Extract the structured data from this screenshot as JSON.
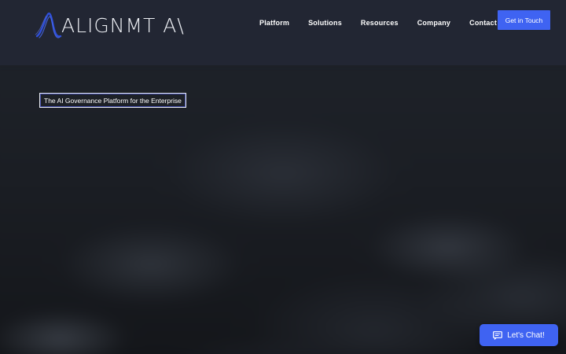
{
  "brand": {
    "name": "ALIGNMT A\\",
    "logo_icon": "wave-logo-icon"
  },
  "nav": {
    "items": [
      {
        "label": "Platform"
      },
      {
        "label": "Solutions"
      },
      {
        "label": "Resources"
      },
      {
        "label": "Company"
      },
      {
        "label": "Contact"
      }
    ],
    "cta_label": "Get in Touch"
  },
  "hero": {
    "tagline": "The AI Governance Platform for the Enterprise"
  },
  "chat": {
    "label": "Let's Chat!",
    "icon": "chat-bubble-icon"
  },
  "colors": {
    "header_bg": "#222633",
    "accent": "#3f63f2",
    "hero_bg": "#15181d"
  }
}
